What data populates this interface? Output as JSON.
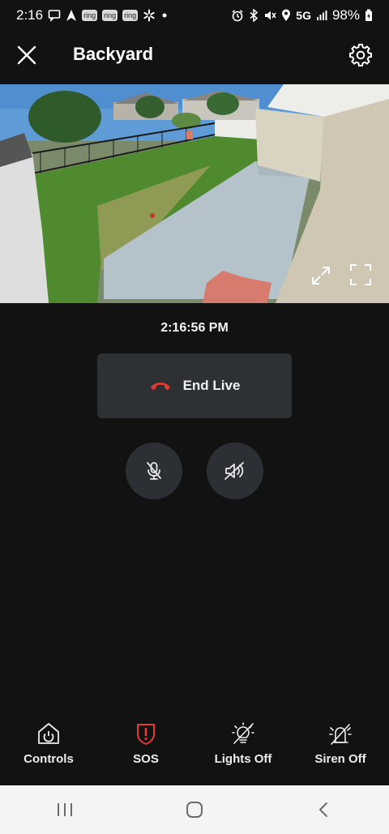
{
  "status_bar": {
    "time": "2:16",
    "ring_badges": [
      "ring",
      "ring",
      "ring"
    ],
    "network": "5G",
    "battery": "98%",
    "icons": [
      "message-icon",
      "navigation-icon",
      "ring-icon",
      "ring-icon",
      "ring-icon",
      "walmart-icon",
      "dot-icon",
      "alarm-icon",
      "bluetooth-icon",
      "mute-icon",
      "location-icon",
      "signal-icon",
      "battery-icon"
    ]
  },
  "header": {
    "title": "Backyard",
    "close_icon": "close-icon",
    "settings_icon": "gear-icon"
  },
  "video": {
    "controls": [
      "expand-icon",
      "fullscreen-icon"
    ]
  },
  "live": {
    "timestamp": "2:16:56 PM",
    "end_label": "End Live",
    "end_icon_color": "#e53935"
  },
  "audio_controls": {
    "mic_icon": "mic-muted-icon",
    "speaker_icon": "speaker-muted-icon"
  },
  "bottom_bar": {
    "items": [
      {
        "label": "Controls",
        "icon": "home-power-icon"
      },
      {
        "label": "SOS",
        "icon": "shield-alert-icon",
        "color": "#e53935"
      },
      {
        "label": "Lights Off",
        "icon": "light-off-icon"
      },
      {
        "label": "Siren Off",
        "icon": "siren-off-icon"
      }
    ]
  },
  "nav_bar": {
    "items": [
      "recents-icon",
      "home-icon",
      "back-icon"
    ]
  }
}
